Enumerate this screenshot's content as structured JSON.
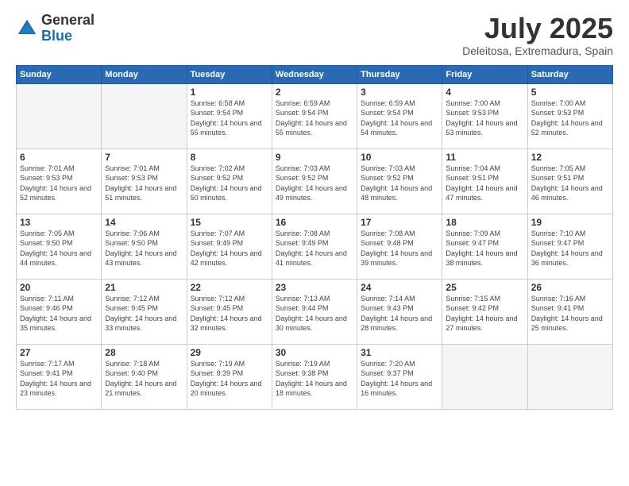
{
  "logo": {
    "general": "General",
    "blue": "Blue"
  },
  "title": "July 2025",
  "subtitle": "Deleitosa, Extremadura, Spain",
  "headers": [
    "Sunday",
    "Monday",
    "Tuesday",
    "Wednesday",
    "Thursday",
    "Friday",
    "Saturday"
  ],
  "weeks": [
    [
      {
        "day": "",
        "sunrise": "",
        "sunset": "",
        "daylight": ""
      },
      {
        "day": "",
        "sunrise": "",
        "sunset": "",
        "daylight": ""
      },
      {
        "day": "1",
        "sunrise": "Sunrise: 6:58 AM",
        "sunset": "Sunset: 9:54 PM",
        "daylight": "Daylight: 14 hours and 55 minutes."
      },
      {
        "day": "2",
        "sunrise": "Sunrise: 6:59 AM",
        "sunset": "Sunset: 9:54 PM",
        "daylight": "Daylight: 14 hours and 55 minutes."
      },
      {
        "day": "3",
        "sunrise": "Sunrise: 6:59 AM",
        "sunset": "Sunset: 9:54 PM",
        "daylight": "Daylight: 14 hours and 54 minutes."
      },
      {
        "day": "4",
        "sunrise": "Sunrise: 7:00 AM",
        "sunset": "Sunset: 9:53 PM",
        "daylight": "Daylight: 14 hours and 53 minutes."
      },
      {
        "day": "5",
        "sunrise": "Sunrise: 7:00 AM",
        "sunset": "Sunset: 9:53 PM",
        "daylight": "Daylight: 14 hours and 52 minutes."
      }
    ],
    [
      {
        "day": "6",
        "sunrise": "Sunrise: 7:01 AM",
        "sunset": "Sunset: 9:53 PM",
        "daylight": "Daylight: 14 hours and 52 minutes."
      },
      {
        "day": "7",
        "sunrise": "Sunrise: 7:01 AM",
        "sunset": "Sunset: 9:53 PM",
        "daylight": "Daylight: 14 hours and 51 minutes."
      },
      {
        "day": "8",
        "sunrise": "Sunrise: 7:02 AM",
        "sunset": "Sunset: 9:52 PM",
        "daylight": "Daylight: 14 hours and 50 minutes."
      },
      {
        "day": "9",
        "sunrise": "Sunrise: 7:03 AM",
        "sunset": "Sunset: 9:52 PM",
        "daylight": "Daylight: 14 hours and 49 minutes."
      },
      {
        "day": "10",
        "sunrise": "Sunrise: 7:03 AM",
        "sunset": "Sunset: 9:52 PM",
        "daylight": "Daylight: 14 hours and 48 minutes."
      },
      {
        "day": "11",
        "sunrise": "Sunrise: 7:04 AM",
        "sunset": "Sunset: 9:51 PM",
        "daylight": "Daylight: 14 hours and 47 minutes."
      },
      {
        "day": "12",
        "sunrise": "Sunrise: 7:05 AM",
        "sunset": "Sunset: 9:51 PM",
        "daylight": "Daylight: 14 hours and 46 minutes."
      }
    ],
    [
      {
        "day": "13",
        "sunrise": "Sunrise: 7:05 AM",
        "sunset": "Sunset: 9:50 PM",
        "daylight": "Daylight: 14 hours and 44 minutes."
      },
      {
        "day": "14",
        "sunrise": "Sunrise: 7:06 AM",
        "sunset": "Sunset: 9:50 PM",
        "daylight": "Daylight: 14 hours and 43 minutes."
      },
      {
        "day": "15",
        "sunrise": "Sunrise: 7:07 AM",
        "sunset": "Sunset: 9:49 PM",
        "daylight": "Daylight: 14 hours and 42 minutes."
      },
      {
        "day": "16",
        "sunrise": "Sunrise: 7:08 AM",
        "sunset": "Sunset: 9:49 PM",
        "daylight": "Daylight: 14 hours and 41 minutes."
      },
      {
        "day": "17",
        "sunrise": "Sunrise: 7:08 AM",
        "sunset": "Sunset: 9:48 PM",
        "daylight": "Daylight: 14 hours and 39 minutes."
      },
      {
        "day": "18",
        "sunrise": "Sunrise: 7:09 AM",
        "sunset": "Sunset: 9:47 PM",
        "daylight": "Daylight: 14 hours and 38 minutes."
      },
      {
        "day": "19",
        "sunrise": "Sunrise: 7:10 AM",
        "sunset": "Sunset: 9:47 PM",
        "daylight": "Daylight: 14 hours and 36 minutes."
      }
    ],
    [
      {
        "day": "20",
        "sunrise": "Sunrise: 7:11 AM",
        "sunset": "Sunset: 9:46 PM",
        "daylight": "Daylight: 14 hours and 35 minutes."
      },
      {
        "day": "21",
        "sunrise": "Sunrise: 7:12 AM",
        "sunset": "Sunset: 9:45 PM",
        "daylight": "Daylight: 14 hours and 33 minutes."
      },
      {
        "day": "22",
        "sunrise": "Sunrise: 7:12 AM",
        "sunset": "Sunset: 9:45 PM",
        "daylight": "Daylight: 14 hours and 32 minutes."
      },
      {
        "day": "23",
        "sunrise": "Sunrise: 7:13 AM",
        "sunset": "Sunset: 9:44 PM",
        "daylight": "Daylight: 14 hours and 30 minutes."
      },
      {
        "day": "24",
        "sunrise": "Sunrise: 7:14 AM",
        "sunset": "Sunset: 9:43 PM",
        "daylight": "Daylight: 14 hours and 28 minutes."
      },
      {
        "day": "25",
        "sunrise": "Sunrise: 7:15 AM",
        "sunset": "Sunset: 9:42 PM",
        "daylight": "Daylight: 14 hours and 27 minutes."
      },
      {
        "day": "26",
        "sunrise": "Sunrise: 7:16 AM",
        "sunset": "Sunset: 9:41 PM",
        "daylight": "Daylight: 14 hours and 25 minutes."
      }
    ],
    [
      {
        "day": "27",
        "sunrise": "Sunrise: 7:17 AM",
        "sunset": "Sunset: 9:41 PM",
        "daylight": "Daylight: 14 hours and 23 minutes."
      },
      {
        "day": "28",
        "sunrise": "Sunrise: 7:18 AM",
        "sunset": "Sunset: 9:40 PM",
        "daylight": "Daylight: 14 hours and 21 minutes."
      },
      {
        "day": "29",
        "sunrise": "Sunrise: 7:19 AM",
        "sunset": "Sunset: 9:39 PM",
        "daylight": "Daylight: 14 hours and 20 minutes."
      },
      {
        "day": "30",
        "sunrise": "Sunrise: 7:19 AM",
        "sunset": "Sunset: 9:38 PM",
        "daylight": "Daylight: 14 hours and 18 minutes."
      },
      {
        "day": "31",
        "sunrise": "Sunrise: 7:20 AM",
        "sunset": "Sunset: 9:37 PM",
        "daylight": "Daylight: 14 hours and 16 minutes."
      },
      {
        "day": "",
        "sunrise": "",
        "sunset": "",
        "daylight": ""
      },
      {
        "day": "",
        "sunrise": "",
        "sunset": "",
        "daylight": ""
      }
    ]
  ]
}
